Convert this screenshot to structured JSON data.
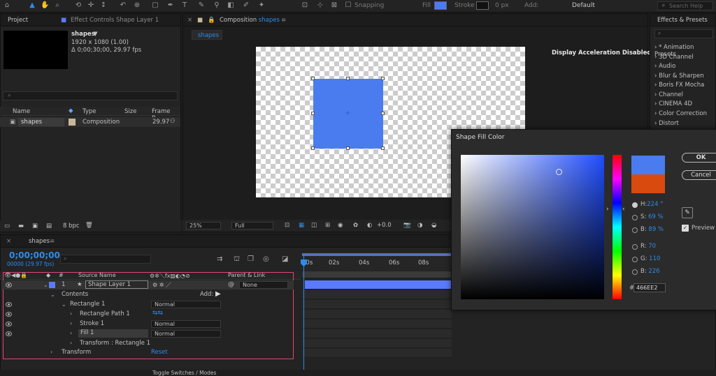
{
  "toolbar": {
    "snapping_label": "Snapping",
    "fill_label": "Fill",
    "stroke_label": "Stroke",
    "stroke_width": "0 px",
    "add_label": "Add:",
    "workspace": "Default",
    "search_placeholder": "Search Help",
    "fill_color": "#4a7cf0",
    "stroke_color": "#111111"
  },
  "project": {
    "tab_project": "Project",
    "tab_effect_controls": "Effect Controls Shape Layer 1",
    "comp_name": "shapes",
    "resolution": "1920 x 1080 (1.00)",
    "duration": "Δ 0;00;30;00, 29.97 fps",
    "columns": [
      "Name",
      "Type",
      "Size",
      "Frame R..."
    ],
    "items": [
      {
        "name": "shapes",
        "type": "Composition",
        "size": "",
        "fps": "29.97"
      }
    ],
    "bpc": "8 bpc"
  },
  "comp": {
    "tab_label": "Composition",
    "tab_name": "shapes",
    "subtab": "shapes",
    "accel_notice": "Display Acceleration Disabled",
    "zoom": "25%",
    "quality": "Full",
    "exposure": "+0.0"
  },
  "effects": {
    "tab": "Effects & Presets",
    "items": [
      "* Animation Presets",
      "3D Channel",
      "Audio",
      "Blur & Sharpen",
      "Boris FX Mocha",
      "Channel",
      "CINEMA 4D",
      "Color Correction",
      "Distort"
    ]
  },
  "timeline": {
    "tab": "shapes",
    "timecode": "0;00;00;00",
    "frame_info": "00000 (29.97 fps)",
    "col_source": "Source Name",
    "col_parent": "Parent & Link",
    "layer_number": "1",
    "layer_name": "Shape Layer 1",
    "parent_value": "None",
    "contents_label": "Contents",
    "add_label": "Add:",
    "rectangle_label": "Rectangle 1",
    "rect_path_label": "Rectangle Path 1",
    "stroke_label": "Stroke 1",
    "fill_label": "Fill 1",
    "transform_rect_label": "Transform : Rectangle 1",
    "transform_label": "Transform",
    "reset_label": "Reset",
    "blend_normal": "Normal",
    "ruler": [
      "00s",
      "02s",
      "04s",
      "06s",
      "08s"
    ],
    "toggle_label": "Toggle Switches / Modes"
  },
  "picker": {
    "title": "Shape Fill Color",
    "ok": "OK",
    "cancel": "Cancel",
    "preview_label": "Preview",
    "new_color": "#4a7cf0",
    "old_color": "#d94a0f",
    "h_label": "H:",
    "h_value": "224 °",
    "s_label": "S:",
    "s_value": "69 %",
    "b_label": "B:",
    "b_value": "89 %",
    "r_label": "R:",
    "r_value": "70",
    "g_label": "G:",
    "g_value": "110",
    "bb_label": "B:",
    "bb_value": "226",
    "hex_prefix": "#",
    "hex_value": "466EE2"
  }
}
